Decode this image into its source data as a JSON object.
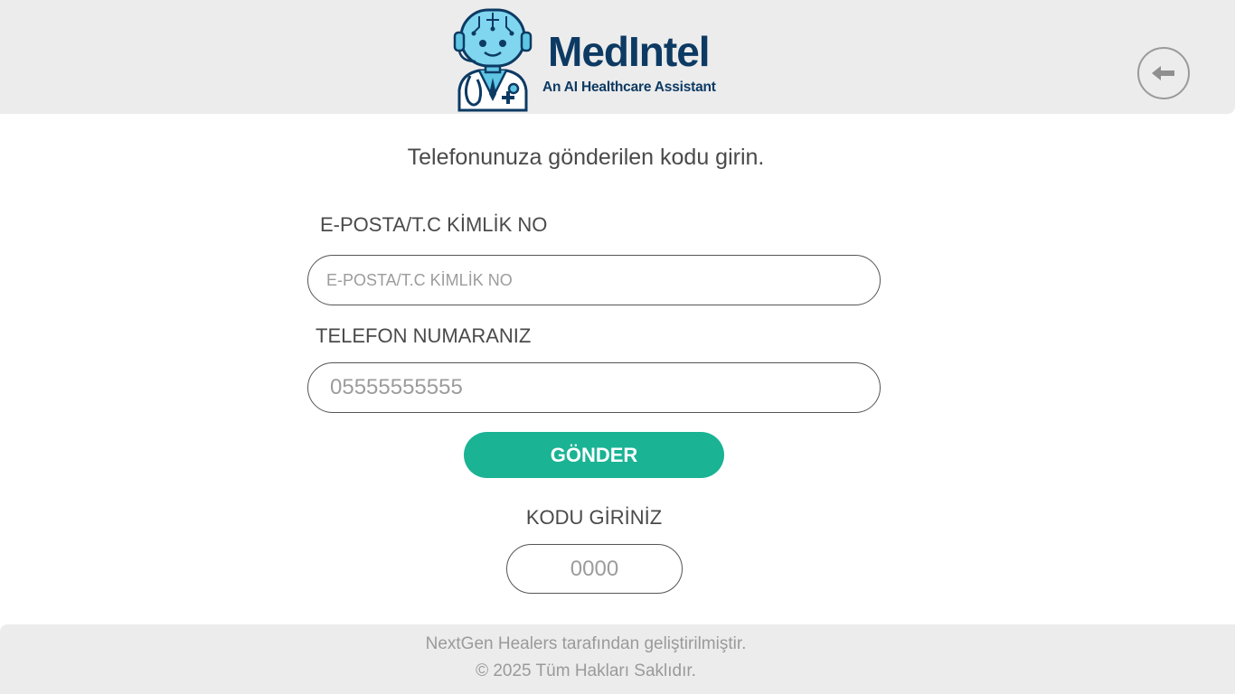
{
  "header": {
    "brand_title": "MedIntel",
    "brand_subtitle": "An AI Healthcare Assistant",
    "back_icon": "arrow-left-icon"
  },
  "main": {
    "instruction": "Telefonunuza gönderilen kodu girin.",
    "email_label": "E-POSTA/T.C KİMLİK NO",
    "email_placeholder": "E-POSTA/T.C KİMLİK NO",
    "phone_label": "TELEFON NUMARANIZ",
    "phone_placeholder": "05555555555",
    "send_label": "GÖNDER",
    "code_label": "KODU GİRİNİZ",
    "code_placeholder": "0000"
  },
  "footer": {
    "line1": "NextGen Healers tarafından geliştirilmiştir.",
    "line2": "© 2025 Tüm Hakları Saklıdır."
  },
  "colors": {
    "brand": "#0d3a63",
    "accent": "#1ab394",
    "header_bg": "#ececec"
  }
}
